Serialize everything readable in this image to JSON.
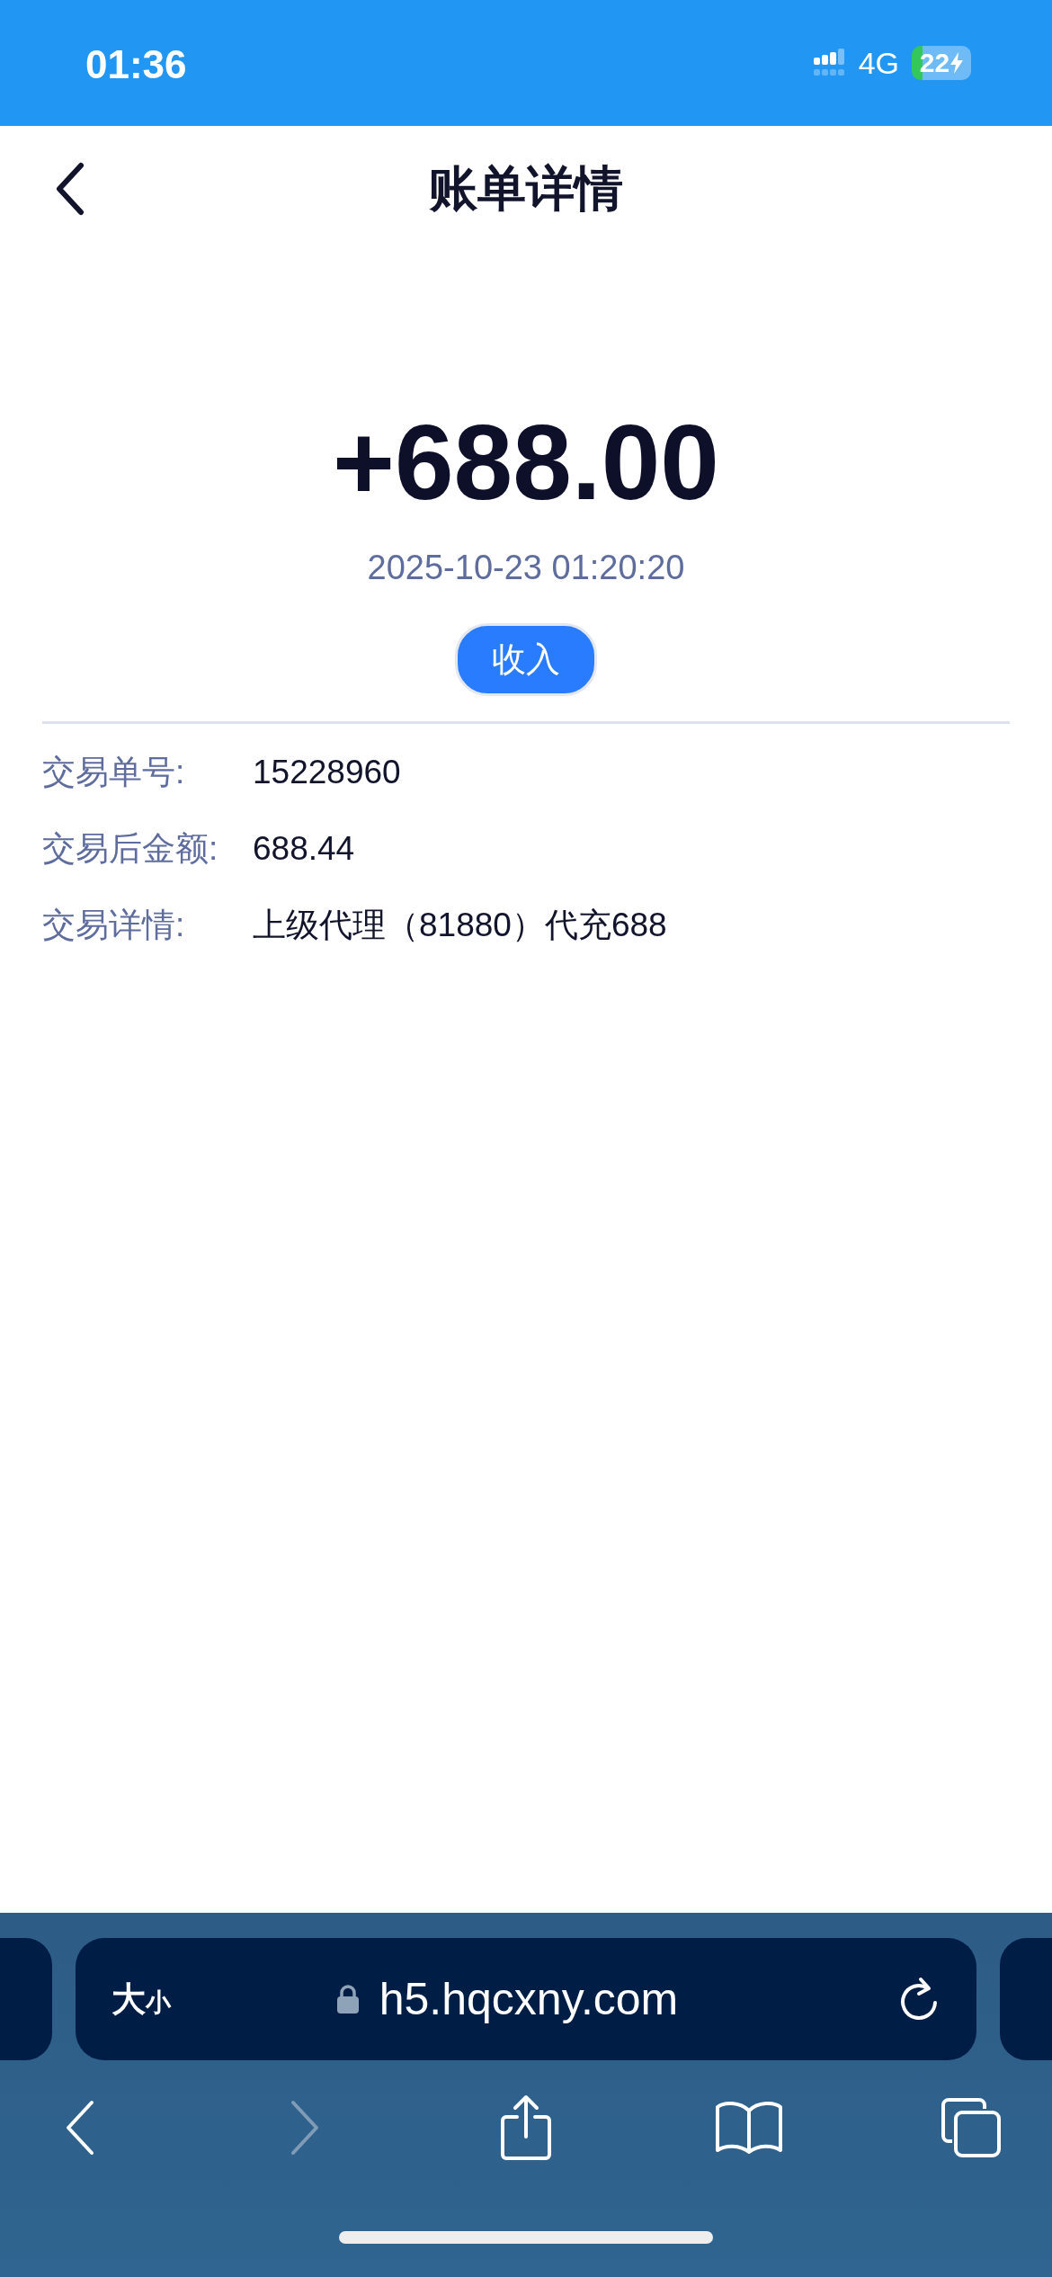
{
  "status_bar": {
    "time": "01:36",
    "network": "4G",
    "battery": "22"
  },
  "header": {
    "title": "账单详情"
  },
  "amount": "+688.00",
  "datetime": "2025-10-23 01:20:20",
  "type_badge": "收入",
  "details": [
    {
      "label": "交易单号:",
      "value": "15228960"
    },
    {
      "label": "交易后金额:",
      "value": "688.44"
    },
    {
      "label": "交易详情:",
      "value": "上级代理（81880）代充688"
    }
  ],
  "browser": {
    "text_size_large": "大",
    "text_size_small": "小",
    "url": "h5.hqcxny.com",
    "toolbar": [
      {
        "kind": "back",
        "disabled": false
      },
      {
        "kind": "forward",
        "disabled": true
      },
      {
        "kind": "share",
        "disabled": false
      },
      {
        "kind": "bookmarks",
        "disabled": false
      },
      {
        "kind": "tabs",
        "disabled": false
      }
    ]
  }
}
